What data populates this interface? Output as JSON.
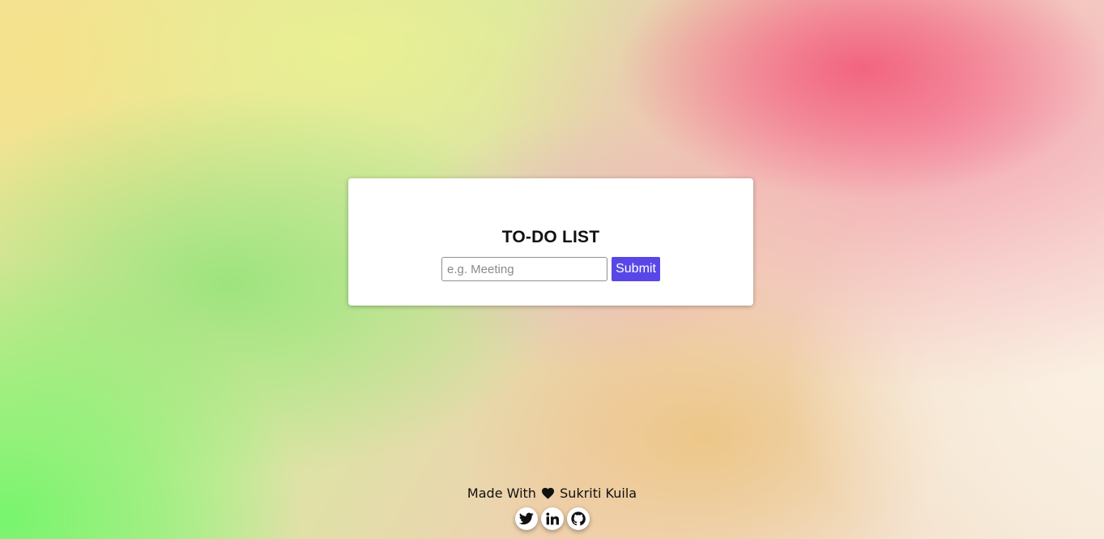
{
  "app": {
    "title": "TO-DO LIST"
  },
  "form": {
    "input_value": "",
    "input_placeholder": "e.g. Meeting",
    "submit_label": "Submit"
  },
  "footer": {
    "made_with": "Made With",
    "author": "Sukriti Kuila",
    "heart_icon": "heart-icon",
    "socials": [
      {
        "icon": "twitter-icon"
      },
      {
        "icon": "linkedin-icon"
      },
      {
        "icon": "github-icon"
      }
    ]
  },
  "colors": {
    "accent": "#5847e6",
    "card_bg": "#ffffff"
  }
}
